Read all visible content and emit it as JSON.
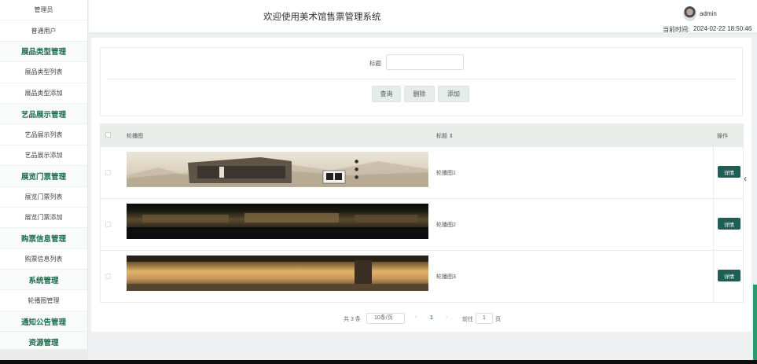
{
  "header": {
    "title": "欢迎使用美术馆售票管理系统",
    "user": "admin",
    "time_label": "当前时间:",
    "time_value": "2024-02-22 18:50:46"
  },
  "sidebar": {
    "items": [
      {
        "label": "管理员",
        "type": "item"
      },
      {
        "label": "普通用户",
        "type": "item"
      },
      {
        "label": "展品类型管理",
        "type": "category"
      },
      {
        "label": "展品类型列表",
        "type": "item"
      },
      {
        "label": "展品类型添加",
        "type": "item"
      },
      {
        "label": "艺品展示管理",
        "type": "category"
      },
      {
        "label": "艺品展示列表",
        "type": "item"
      },
      {
        "label": "艺品展示添加",
        "type": "item"
      },
      {
        "label": "展览门票管理",
        "type": "category"
      },
      {
        "label": "展览门票列表",
        "type": "item"
      },
      {
        "label": "展览门票添加",
        "type": "item"
      },
      {
        "label": "购票信息管理",
        "type": "category"
      },
      {
        "label": "购票信息列表",
        "type": "item"
      },
      {
        "label": "系统管理",
        "type": "category"
      },
      {
        "label": "轮播图管理",
        "type": "item"
      },
      {
        "label": "通知公告管理",
        "type": "category"
      },
      {
        "label": "资源管理",
        "type": "category"
      }
    ]
  },
  "search": {
    "label": "标题",
    "value": "",
    "placeholder": ""
  },
  "buttons": {
    "query": "查询",
    "delete": "删除",
    "add": "添加"
  },
  "table": {
    "headers": {
      "image": "轮播图",
      "title": "标题 ⇕",
      "op": "操作"
    },
    "rows": [
      {
        "title": "轮播图1",
        "action": "详情"
      },
      {
        "title": "轮播图2",
        "action": "详情"
      },
      {
        "title": "轮播图3",
        "action": "详情"
      }
    ]
  },
  "pagination": {
    "total": "共 3 条",
    "page_size": "10条/页",
    "prev": "‹",
    "current": "1",
    "next": "›",
    "goto": "前往",
    "goto_value": "1",
    "page_unit": "页"
  },
  "colors": {
    "accent": "#1e6b4c",
    "detail_button": "#1f5e54",
    "page_active": "#1f8fd8"
  }
}
